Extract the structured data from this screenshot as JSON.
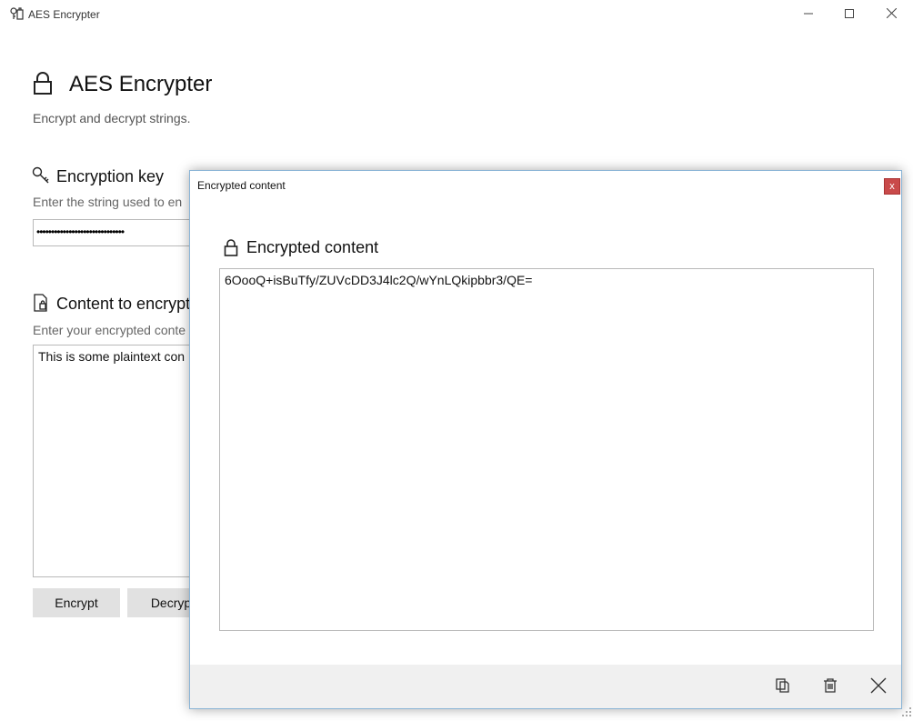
{
  "window": {
    "title": "AES Encrypter",
    "icons": [
      "app-icon",
      "minimize-icon",
      "maximize-icon",
      "close-icon"
    ]
  },
  "header": {
    "title": "AES Encrypter",
    "subtitle": "Encrypt and decrypt strings.",
    "icon": "lock-icon"
  },
  "key_section": {
    "title": "Encryption key",
    "description": "Enter the string used to en",
    "value_masked": "••••••••••••••••••••••••••••••",
    "icon": "key-icon"
  },
  "content_section": {
    "title": "Content to encrypt",
    "description": "Enter your encrypted conte",
    "value": "This is some plaintext con",
    "icon": "document-lock-icon"
  },
  "buttons": {
    "encrypt": "Encrypt",
    "decrypt": "Decryp"
  },
  "dialog": {
    "title": "Encrypted content",
    "close_label": "x",
    "heading": "Encrypted content",
    "content": "6OooQ+isBuTfy/ZUVcDD3J4lc2Q/wYnLQkipbbr3/QE=",
    "footer_icons": [
      "copy-icon",
      "delete-icon",
      "close-icon"
    ]
  },
  "colors": {
    "button_bg": "#e1e1e1",
    "footer_bg": "#f0f0f0",
    "dialog_close_bg": "#c94a4a",
    "dialog_border": "#8ab4d6"
  }
}
